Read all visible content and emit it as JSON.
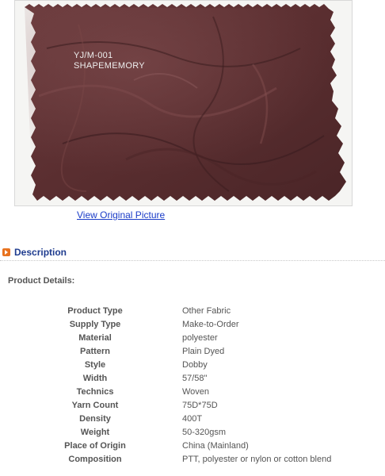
{
  "product_image": {
    "caption_code": "YJ/M-001",
    "caption_name": "SHAPEMEMORY",
    "view_original_label": "View Original Picture"
  },
  "description": {
    "title": "Description",
    "details_heading": "Product Details:",
    "details": [
      {
        "key": "Product Type",
        "value": "Other Fabric"
      },
      {
        "key": "Supply Type",
        "value": "Make-to-Order"
      },
      {
        "key": "Material",
        "value": "polyester"
      },
      {
        "key": "Pattern",
        "value": "Plain Dyed"
      },
      {
        "key": "Style",
        "value": "Dobby"
      },
      {
        "key": "Width",
        "value": "57/58\""
      },
      {
        "key": "Technics",
        "value": "Woven"
      },
      {
        "key": "Yarn Count",
        "value": "75D*75D"
      },
      {
        "key": "Density",
        "value": "400T"
      },
      {
        "key": "Weight",
        "value": "50-320gsm"
      },
      {
        "key": "Place of Origin",
        "value": "China (Mainland)"
      },
      {
        "key": "Composition",
        "value": "PTT, polyester or nylon or cotton blend"
      }
    ]
  },
  "colors": {
    "fabric": "#5b2f31",
    "link": "#1a3cc8",
    "section_title": "#1f3c8f",
    "section_icon": "#e8731f"
  }
}
